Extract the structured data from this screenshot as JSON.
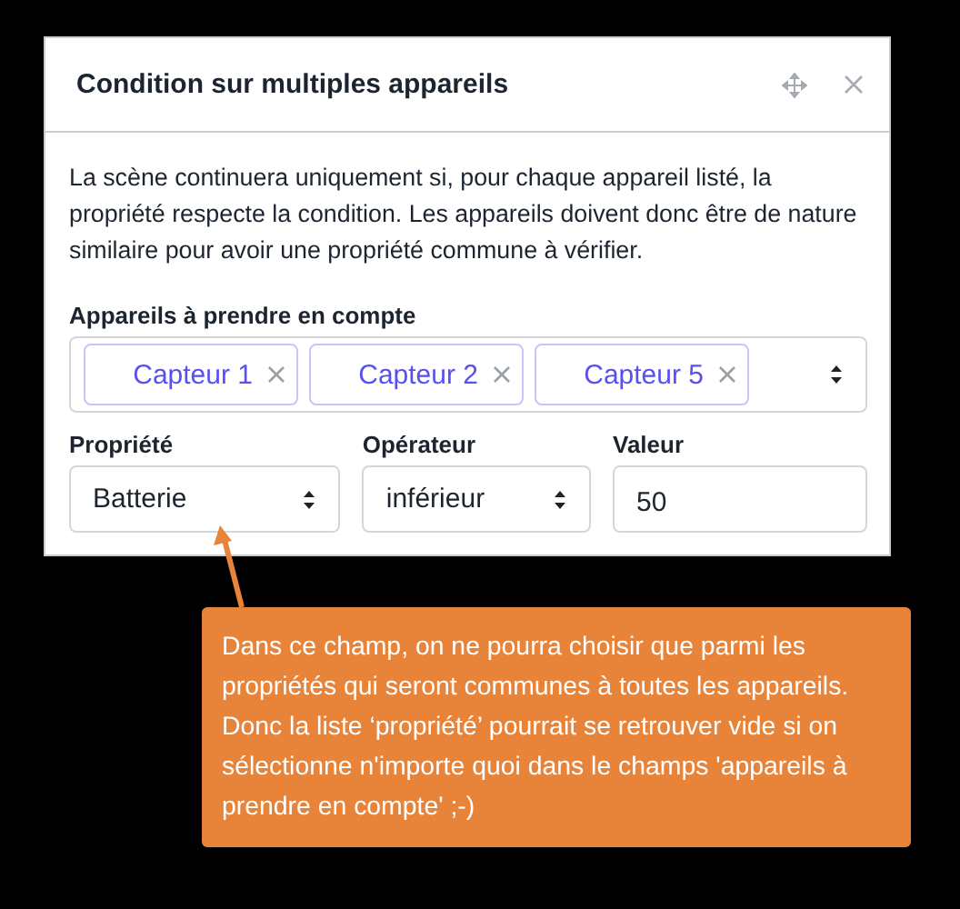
{
  "dialog": {
    "title": "Condition sur multiples appareils",
    "description": "La scène continuera uniquement si, pour chaque appareil listé, la propriété respecte la condition. Les appareils doivent donc être de nature similaire pour avoir une propriété commune à vérifier.",
    "devices": {
      "label": "Appareils à prendre en compte",
      "tags": [
        "Capteur 1",
        "Capteur 2",
        "Capteur 5"
      ]
    },
    "fields": [
      {
        "kind": "select",
        "label": "Propriété",
        "value": "Batterie"
      },
      {
        "kind": "select",
        "label": "Opérateur",
        "value": "inférieur"
      },
      {
        "kind": "input",
        "label": "Valeur",
        "value": "50"
      }
    ]
  },
  "note": {
    "text": "Dans ce champ, on ne pourra choisir que parmi les propriétés qui seront communes à toutes les appareils. Donc la liste ‘propriété’ pourrait se retrouver vide si on sélectionne n'importe quoi dans le champs 'appareils à prendre en compte' ;-)"
  }
}
